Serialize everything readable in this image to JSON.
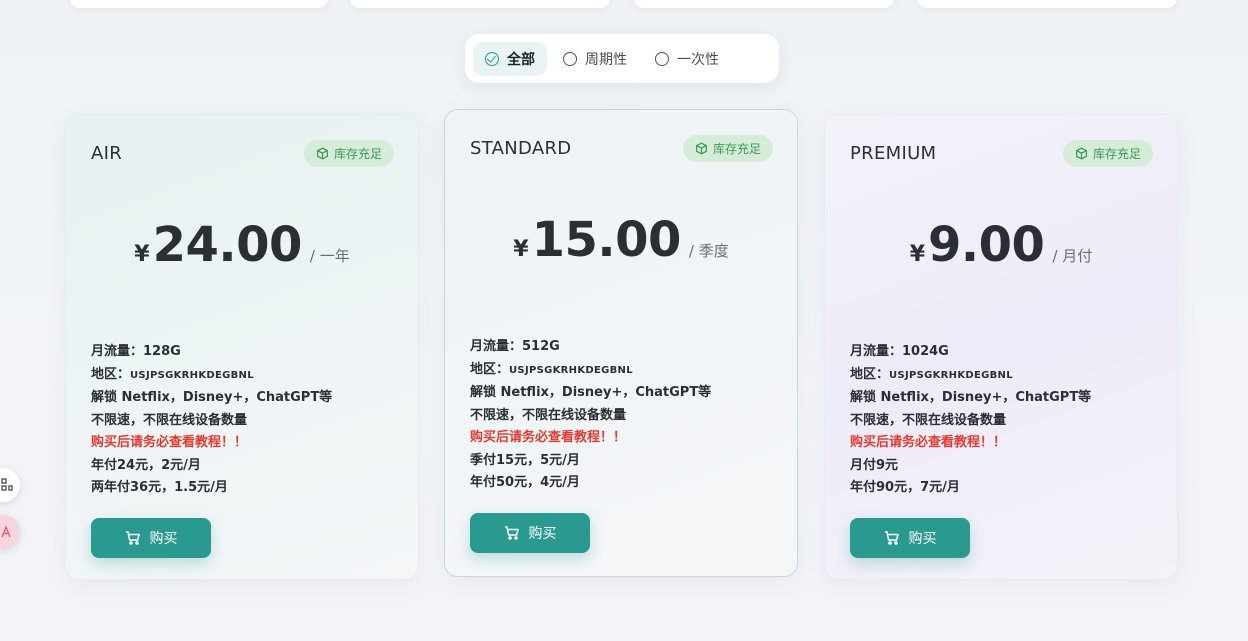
{
  "filter": {
    "options": [
      {
        "label": "全部",
        "active": true
      },
      {
        "label": "周期性",
        "active": false
      },
      {
        "label": "一次性",
        "active": false
      }
    ]
  },
  "plans": [
    {
      "name": "AIR",
      "stock": "库存充足",
      "currency": "¥",
      "price": "24.00",
      "period": "/ 一年",
      "features": [
        "月流量：128G",
        "地区：",
        "USJPSGKRHKDEGBNL",
        "解锁 Netflix，Disney+，ChatGPT等",
        "不限速，不限在线设备数量",
        "购买后请务必查看教程！！",
        "年付24元，2元/月",
        "两年付36元，1.5元/月"
      ],
      "buy": "购买"
    },
    {
      "name": "STANDARD",
      "stock": "库存充足",
      "currency": "¥",
      "price": "15.00",
      "period": "/ 季度",
      "features": [
        "月流量：512G",
        "地区：",
        "USJPSGKRHKDEGBNL",
        "解锁 Netflix，Disney+，ChatGPT等",
        "不限速，不限在线设备数量",
        "购买后请务必查看教程！！",
        "季付15元，5元/月",
        "年付50元，4元/月"
      ],
      "buy": "购买"
    },
    {
      "name": "PREMIUM",
      "stock": "库存充足",
      "currency": "¥",
      "price": "9.00",
      "period": "/ 月付",
      "features": [
        "月流量：1024G",
        "地区：",
        "USJPSGKRHKDEGBNL",
        "解锁 Netflix，Disney+，ChatGPT等",
        "不限速，不限在线设备数量",
        "购买后请务必查看教程！！",
        "月付9元",
        "年付90元，7元/月"
      ],
      "buy": "购买"
    }
  ],
  "colors": {
    "accent": "#2a9a90",
    "warning": "#e03c31",
    "stock_bg": "#d5ecd9",
    "stock_text": "#3b9a55"
  },
  "icons": {
    "filter_active": "check-circle-icon",
    "filter_inactive": "radio-circle-icon",
    "stock": "cube-icon",
    "buy": "cart-icon",
    "float_1": "apps-grid-icon",
    "float_2": "translate-icon"
  }
}
